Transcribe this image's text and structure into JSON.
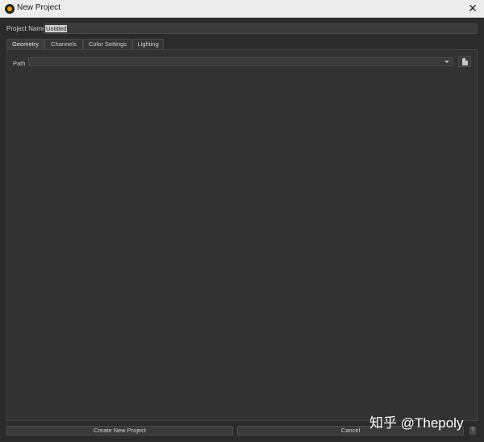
{
  "window": {
    "title": "New Project",
    "icon": "app-logo-icon",
    "close": "close-icon"
  },
  "project": {
    "name_label": "Project Name",
    "name_value": "Untitled"
  },
  "tabs": [
    {
      "label": "Geometry",
      "active": true
    },
    {
      "label": "Channels",
      "active": false
    },
    {
      "label": "Color Settings",
      "active": false
    },
    {
      "label": "Lighting",
      "active": false
    }
  ],
  "geometry": {
    "path_label": "Path",
    "path_value": "",
    "browse_icon": "file-icon"
  },
  "footer": {
    "create_label": "Create New Project",
    "cancel_label": "Cancel",
    "help_label": "?"
  },
  "watermark": {
    "text": "知乎 @Thepoly"
  },
  "colors": {
    "background": "#2b2b2b",
    "panel": "#323232",
    "titlebar": "#ededed"
  }
}
